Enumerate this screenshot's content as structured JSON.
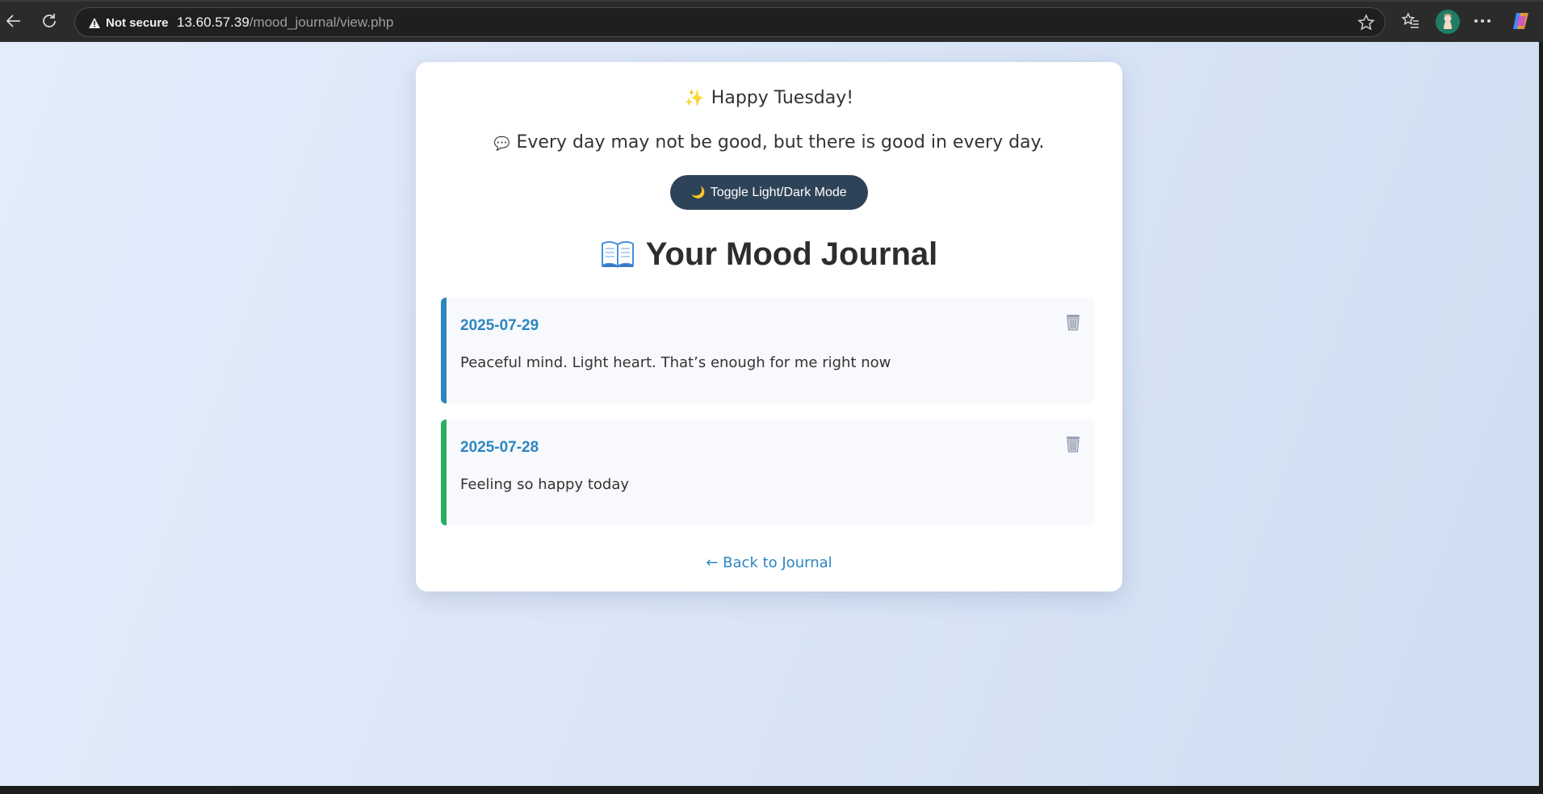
{
  "browser": {
    "security_label": "Not secure",
    "url_host": "13.60.57.39",
    "url_path": "/mood_journal/view.php"
  },
  "page": {
    "greeting_emoji": "✨",
    "greeting": "Happy Tuesday!",
    "quote_emoji": "💬",
    "quote": "Every day may not be good, but there is good in every day.",
    "toggle_emoji": "🌙",
    "toggle_label": "Toggle Light/Dark Mode",
    "heading": "Your Mood Journal",
    "entries": [
      {
        "date": "2025-07-29",
        "text": "Peaceful mind. Light heart. That’s enough for me right now",
        "accent": "#2e86c1"
      },
      {
        "date": "2025-07-28",
        "text": "Feeling so happy today",
        "accent": "#27ae60"
      }
    ],
    "back_link": "← Back to Journal"
  },
  "colors": {
    "primary": "#2e86c1",
    "success": "#27ae60",
    "button_bg": "#2f4358"
  }
}
